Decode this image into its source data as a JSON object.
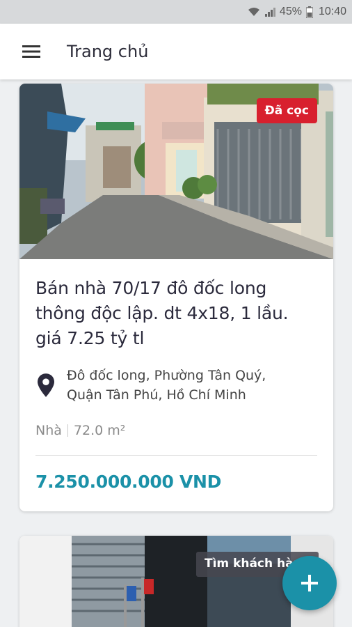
{
  "status_bar": {
    "battery": "45%",
    "time": "10:40",
    "icons": [
      "wifi-icon",
      "signal-icon",
      "battery-icon"
    ]
  },
  "app_bar": {
    "title": "Trang chủ",
    "menu_icon": "hamburger-menu-icon"
  },
  "listings": [
    {
      "badge": "Đã cọc",
      "title": "Bán nhà 70/17 đô đốc long thông độc lập. dt 4x18, 1 lầu. giá 7.25 tỷ tl",
      "address_line1": "Đô đốc long, Phường Tân Quý,",
      "address_line2": "Quận Tân Phú, Hồ Chí Minh",
      "property_type": "Nhà",
      "area": "72.0 m²",
      "price": "7.250.000.000 VND"
    }
  ],
  "tooltip": "Tìm khách hàng",
  "fab": {
    "icon": "plus-icon"
  },
  "colors": {
    "accent": "#1b91a8",
    "badge": "#d8202e",
    "title_text": "#2b2a3c"
  }
}
